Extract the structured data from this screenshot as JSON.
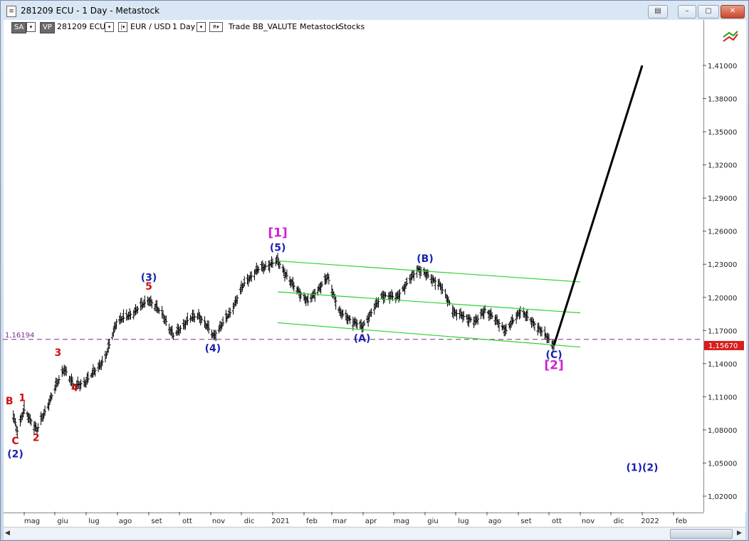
{
  "window": {
    "title": "281209 ECU - 1 Day - Metastock",
    "icon": "document-icon",
    "controls": [
      "restore-icon",
      "minimize-icon",
      "maximize-icon",
      "close-icon"
    ]
  },
  "toolbar": {
    "sa_label": "SA",
    "vp_label": "VP",
    "symbol": "281209 ECU",
    "security_name": "EUR / USD",
    "period": "1 Day",
    "r_label": "R",
    "trade": "Trade",
    "source": "BB_VALUTE",
    "group": "Metastock",
    "category": "Stocks"
  },
  "axis_icon": "trend-arrows-icon",
  "chart_data": {
    "type": "ohlc-bar",
    "x_labels": [
      "mag",
      "giu",
      "lug",
      "ago",
      "set",
      "ott",
      "nov",
      "dic",
      "2021",
      "feb",
      "mar",
      "apr",
      "mag",
      "giu",
      "lug",
      "ago",
      "set",
      "ott",
      "nov",
      "dic",
      "2022",
      "feb"
    ],
    "y_ticks": [
      "1,41000",
      "1,38000",
      "1,35000",
      "1,32000",
      "1,29000",
      "1,26000",
      "1,23000",
      "1,20000",
      "1,17000",
      "1,14000",
      "1,11000",
      "1,08000",
      "1,05000",
      "1,02000"
    ],
    "ylim": [
      1.0,
      1.42
    ],
    "reference_line": {
      "label": "1,16194",
      "value": 1.16194
    },
    "last_price": {
      "label": "1,15670",
      "value": 1.1567
    },
    "price_series": [
      {
        "date": "2020-04-20",
        "value": 1.094
      },
      {
        "date": "2020-04-24",
        "value": 1.079
      },
      {
        "date": "2020-05-01",
        "value": 1.098
      },
      {
        "date": "2020-05-14",
        "value": 1.08
      },
      {
        "date": "2020-05-29",
        "value": 1.111
      },
      {
        "date": "2020-06-10",
        "value": 1.136
      },
      {
        "date": "2020-06-19",
        "value": 1.12
      },
      {
        "date": "2020-06-30",
        "value": 1.123
      },
      {
        "date": "2020-07-20",
        "value": 1.145
      },
      {
        "date": "2020-07-31",
        "value": 1.178
      },
      {
        "date": "2020-08-15",
        "value": 1.185
      },
      {
        "date": "2020-09-01",
        "value": 1.198
      },
      {
        "date": "2020-09-15",
        "value": 1.184
      },
      {
        "date": "2020-09-25",
        "value": 1.165
      },
      {
        "date": "2020-10-10",
        "value": 1.18
      },
      {
        "date": "2020-10-20",
        "value": 1.184
      },
      {
        "date": "2020-11-04",
        "value": 1.165
      },
      {
        "date": "2020-11-20",
        "value": 1.186
      },
      {
        "date": "2020-12-04",
        "value": 1.213
      },
      {
        "date": "2020-12-17",
        "value": 1.225
      },
      {
        "date": "2021-01-06",
        "value": 1.233
      },
      {
        "date": "2021-01-20",
        "value": 1.212
      },
      {
        "date": "2021-02-05",
        "value": 1.196
      },
      {
        "date": "2021-02-25",
        "value": 1.218
      },
      {
        "date": "2021-03-09",
        "value": 1.186
      },
      {
        "date": "2021-03-31",
        "value": 1.173
      },
      {
        "date": "2021-04-20",
        "value": 1.202
      },
      {
        "date": "2021-05-04",
        "value": 1.2
      },
      {
        "date": "2021-05-25",
        "value": 1.226
      },
      {
        "date": "2021-06-15",
        "value": 1.212
      },
      {
        "date": "2021-06-30",
        "value": 1.186
      },
      {
        "date": "2021-07-21",
        "value": 1.178
      },
      {
        "date": "2021-07-30",
        "value": 1.189
      },
      {
        "date": "2021-08-20",
        "value": 1.17
      },
      {
        "date": "2021-09-03",
        "value": 1.188
      },
      {
        "date": "2021-09-20",
        "value": 1.173
      },
      {
        "date": "2021-10-06",
        "value": 1.1567
      }
    ],
    "projection": [
      {
        "date": "2021-10-06",
        "value": 1.1567
      },
      {
        "date": "2022-01-01",
        "value": 1.41
      }
    ],
    "channel_lines": [
      [
        {
          "date": "2021-01-06",
          "value": 1.233
        },
        {
          "date": "2021-11-01",
          "value": 1.214
        }
      ],
      [
        {
          "date": "2021-01-06",
          "value": 1.205
        },
        {
          "date": "2021-11-01",
          "value": 1.186
        }
      ],
      [
        {
          "date": "2021-01-06",
          "value": 1.177
        },
        {
          "date": "2021-11-01",
          "value": 1.155
        }
      ]
    ],
    "wave_labels": [
      {
        "text": "B",
        "color": "#d01010",
        "date": "2020-04-16",
        "value": 1.103
      },
      {
        "text": "1",
        "color": "#d01010",
        "date": "2020-04-29",
        "value": 1.106
      },
      {
        "text": "C",
        "color": "#d01010",
        "date": "2020-04-22",
        "value": 1.067
      },
      {
        "text": "2",
        "color": "#d01010",
        "date": "2020-05-13",
        "value": 1.07
      },
      {
        "text": "3",
        "color": "#d01010",
        "date": "2020-06-04",
        "value": 1.147
      },
      {
        "text": "4",
        "color": "#d01010",
        "date": "2020-06-20",
        "value": 1.115
      },
      {
        "text": "5",
        "color": "#d01010",
        "date": "2020-09-01",
        "value": 1.207
      },
      {
        "text": "(2)",
        "color": "#1a22b0",
        "date": "2020-04-22",
        "value": 1.055
      },
      {
        "text": "(3)",
        "color": "#1a22b0",
        "date": "2020-09-01",
        "value": 1.215
      },
      {
        "text": "(4)",
        "color": "#1a22b0",
        "date": "2020-11-03",
        "value": 1.151
      },
      {
        "text": "(5)",
        "color": "#1a22b0",
        "date": "2021-01-06",
        "value": 1.242
      },
      {
        "text": "[1]",
        "color": "#d020d0",
        "date": "2021-01-06",
        "value": 1.255
      },
      {
        "text": "(A)",
        "color": "#1a22b0",
        "date": "2021-03-31",
        "value": 1.16
      },
      {
        "text": "(B)",
        "color": "#1a22b0",
        "date": "2021-06-01",
        "value": 1.232
      },
      {
        "text": "(C)",
        "color": "#1a22b0",
        "date": "2021-10-06",
        "value": 1.145
      },
      {
        "text": "[2]",
        "color": "#d020d0",
        "date": "2021-10-06",
        "value": 1.135
      },
      {
        "text": "(1)(2)",
        "color": "#1a22b0",
        "date": "2022-01-01",
        "value": 1.043
      }
    ]
  }
}
